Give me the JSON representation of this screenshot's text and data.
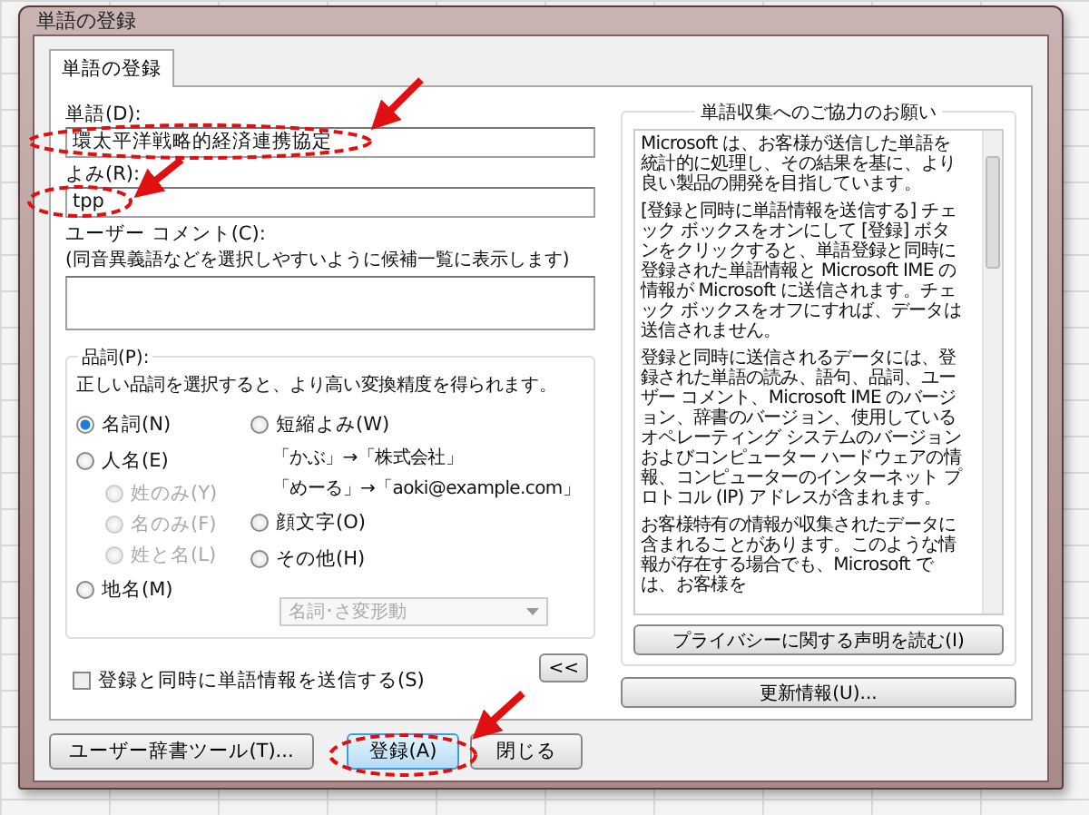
{
  "window": {
    "title": "単語の登録"
  },
  "tabs": [
    {
      "label": "単語の登録",
      "selected": true
    }
  ],
  "word": {
    "label": "単語(D):",
    "value": "環太平洋戦略的経済連携協定"
  },
  "reading": {
    "label": "よみ(R):",
    "value": "tpp"
  },
  "comment": {
    "label": "ユーザー コメント(C):",
    "hint": "(同音異義語などを選択しやすいように候補一覧に表示します)"
  },
  "part_of_speech": {
    "label": "品詞(P):",
    "description": "正しい品詞を選択すると、より高い変換精度を得られます。",
    "left_options": [
      {
        "label": "名詞(N)",
        "selected": true,
        "disabled": false
      },
      {
        "label": "人名(E)",
        "selected": false,
        "disabled": false,
        "children": [
          {
            "label": "姓のみ(Y)",
            "selected": false,
            "disabled": true
          },
          {
            "label": "名のみ(F)",
            "selected": false,
            "disabled": true
          },
          {
            "label": "姓と名(L)",
            "selected": false,
            "disabled": true
          }
        ]
      },
      {
        "label": "地名(M)",
        "selected": false,
        "disabled": false
      }
    ],
    "right_options": [
      {
        "label": "短縮よみ(W)",
        "selected": false,
        "disabled": false,
        "examples": [
          "「かぶ」→「株式会社」",
          "「めーる」→「aoki@example.com」"
        ]
      },
      {
        "label": "顔文字(O)",
        "selected": false,
        "disabled": false
      },
      {
        "label": "その他(H)",
        "selected": false,
        "disabled": false
      }
    ],
    "dropdown": {
      "value": "名詞･さ変形動",
      "disabled": true
    }
  },
  "send_checkbox": {
    "label": "登録と同時に単語情報を送信する(S)",
    "checked": false
  },
  "collapse_button": "<<",
  "info_group": {
    "title": "単語収集へのご協力のお願い",
    "paragraphs": [
      "Microsoft は、お客様が送信した単語を統計的に処理し、その結果を基に、より良い製品の開発を目指しています。",
      "[登録と同時に単語情報を送信する] チェック ボックスをオンにして [登録] ボタンをクリックすると、単語登録と同時に登録された単語情報と Microsoft IME の情報が Microsoft に送信されます。チェック ボックスをオフにすれば、データは送信されません。",
      "登録と同時に送信されるデータには、登録された単語の読み、語句、品詞、ユーザー コメント、Microsoft IME のバージョン、辞書のバージョン、使用しているオペレーティング システムのバージョンおよびコンピューター ハードウェアの情報、コンピューターのインターネット プロトコル (IP) アドレスが含まれます。",
      "お客様特有の情報が収集されたデータに含まれることがあります。このような情報が存在する場合でも、Microsoft では、お客様を"
    ],
    "privacy_button": "プライバシーに関する声明を読む(I)"
  },
  "update_button": "更新情報(U)...",
  "buttons": [
    {
      "label": "ユーザー辞書ツール(T)...",
      "default": false
    },
    {
      "label": "登録(A)",
      "default": true
    },
    {
      "label": "閉じる",
      "default": false
    }
  ]
}
